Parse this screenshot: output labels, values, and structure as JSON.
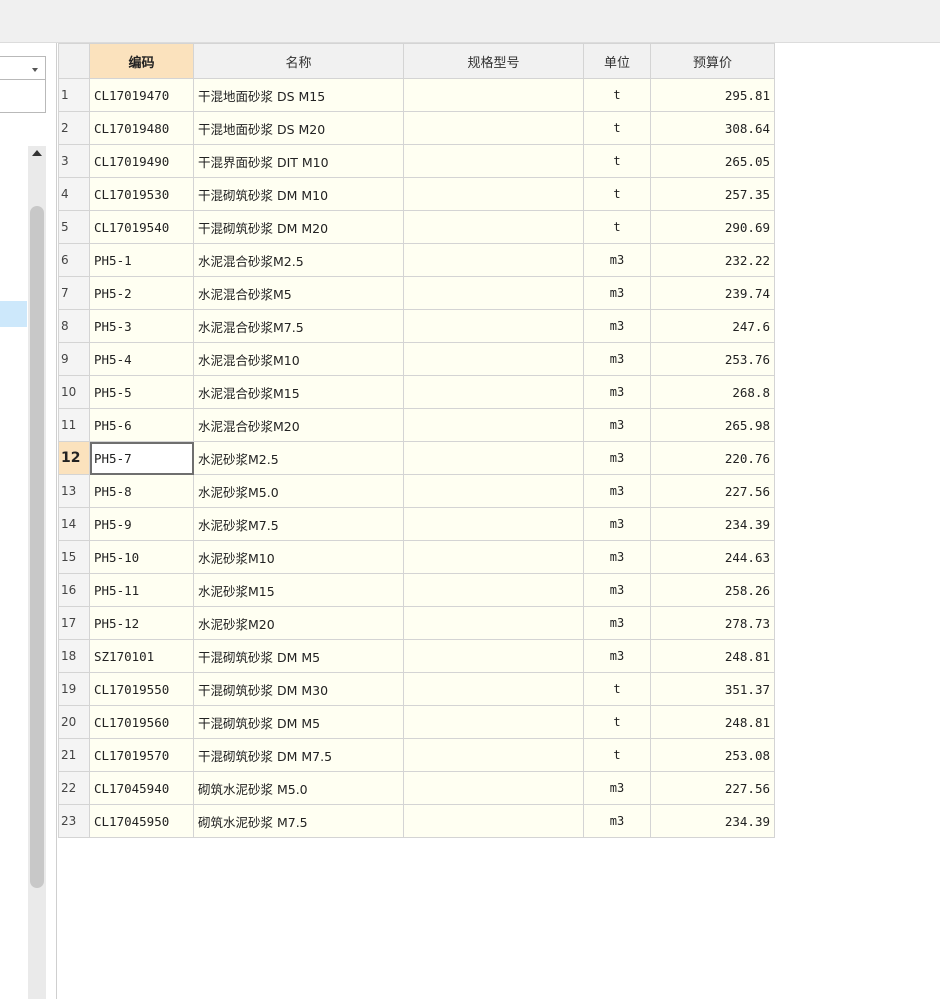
{
  "table": {
    "columns": [
      "编码",
      "名称",
      "规格型号",
      "单位",
      "预算价"
    ],
    "current_row": 12,
    "rows": [
      {
        "no": "1",
        "code": "CL17019470",
        "name": "干混地面砂浆 DS M15",
        "spec": "",
        "unit": "t",
        "price": "295.81"
      },
      {
        "no": "2",
        "code": "CL17019480",
        "name": "干混地面砂浆 DS M20",
        "spec": "",
        "unit": "t",
        "price": "308.64"
      },
      {
        "no": "3",
        "code": "CL17019490",
        "name": "干混界面砂浆 DIT M10",
        "spec": "",
        "unit": "t",
        "price": "265.05"
      },
      {
        "no": "4",
        "code": "CL17019530",
        "name": "干混砌筑砂浆 DM M10",
        "spec": "",
        "unit": "t",
        "price": "257.35"
      },
      {
        "no": "5",
        "code": "CL17019540",
        "name": "干混砌筑砂浆 DM M20",
        "spec": "",
        "unit": "t",
        "price": "290.69"
      },
      {
        "no": "6",
        "code": "PH5-1",
        "name": "水泥混合砂浆M2.5",
        "spec": "",
        "unit": "m3",
        "price": "232.22"
      },
      {
        "no": "7",
        "code": "PH5-2",
        "name": "水泥混合砂浆M5",
        "spec": "",
        "unit": "m3",
        "price": "239.74"
      },
      {
        "no": "8",
        "code": "PH5-3",
        "name": "水泥混合砂浆M7.5",
        "spec": "",
        "unit": "m3",
        "price": "247.6"
      },
      {
        "no": "9",
        "code": "PH5-4",
        "name": "水泥混合砂浆M10",
        "spec": "",
        "unit": "m3",
        "price": "253.76"
      },
      {
        "no": "10",
        "code": "PH5-5",
        "name": "水泥混合砂浆M15",
        "spec": "",
        "unit": "m3",
        "price": "268.8"
      },
      {
        "no": "11",
        "code": "PH5-6",
        "name": "水泥混合砂浆M20",
        "spec": "",
        "unit": "m3",
        "price": "265.98"
      },
      {
        "no": "12",
        "code": "PH5-7",
        "name": "水泥砂浆M2.5",
        "spec": "",
        "unit": "m3",
        "price": "220.76"
      },
      {
        "no": "13",
        "code": "PH5-8",
        "name": "水泥砂浆M5.0",
        "spec": "",
        "unit": "m3",
        "price": "227.56"
      },
      {
        "no": "14",
        "code": "PH5-9",
        "name": "水泥砂浆M7.5",
        "spec": "",
        "unit": "m3",
        "price": "234.39"
      },
      {
        "no": "15",
        "code": "PH5-10",
        "name": "水泥砂浆M10",
        "spec": "",
        "unit": "m3",
        "price": "244.63"
      },
      {
        "no": "16",
        "code": "PH5-11",
        "name": "水泥砂浆M15",
        "spec": "",
        "unit": "m3",
        "price": "258.26"
      },
      {
        "no": "17",
        "code": "PH5-12",
        "name": "水泥砂浆M20",
        "spec": "",
        "unit": "m3",
        "price": "278.73"
      },
      {
        "no": "18",
        "code": "SZ170101",
        "name": "干混砌筑砂浆 DM M5",
        "spec": "",
        "unit": "m3",
        "price": "248.81"
      },
      {
        "no": "19",
        "code": "CL17019550",
        "name": "干混砌筑砂浆 DM M30",
        "spec": "",
        "unit": "t",
        "price": "351.37"
      },
      {
        "no": "20",
        "code": "CL17019560",
        "name": "干混砌筑砂浆 DM M5",
        "spec": "",
        "unit": "t",
        "price": "248.81"
      },
      {
        "no": "21",
        "code": "CL17019570",
        "name": "干混砌筑砂浆 DM M7.5",
        "spec": "",
        "unit": "t",
        "price": "253.08"
      },
      {
        "no": "22",
        "code": "CL17045940",
        "name": "砌筑水泥砂浆 M5.0",
        "spec": "",
        "unit": "m3",
        "price": "227.56"
      },
      {
        "no": "23",
        "code": "CL17045950",
        "name": "砌筑水泥砂浆 M7.5",
        "spec": "",
        "unit": "m3",
        "price": "234.39"
      }
    ]
  },
  "colors": {
    "header_sorted_bg": "#fbe2bd",
    "cell_bg": "#fffff2",
    "selection_bg": "#cde8fb"
  }
}
